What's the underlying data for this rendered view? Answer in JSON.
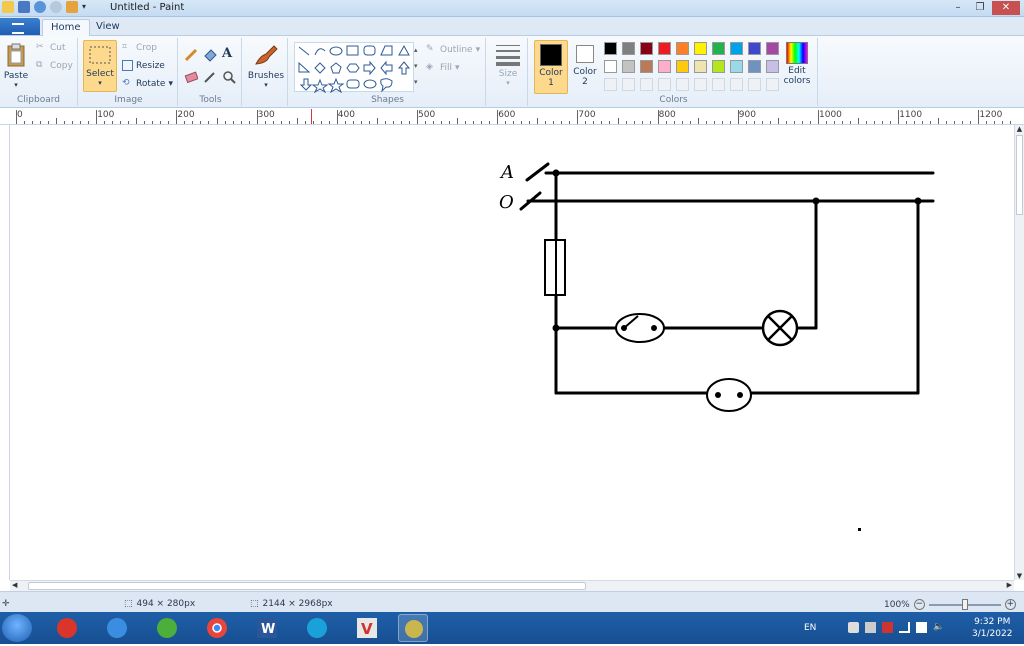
{
  "window": {
    "title": "Untitled - Paint"
  },
  "tabs": [
    {
      "label": "Home"
    },
    {
      "label": "View"
    }
  ],
  "ribbon": {
    "clipboard": {
      "label": "Clipboard",
      "paste": "Paste",
      "cut": "Cut",
      "copy": "Copy"
    },
    "image": {
      "label": "Image",
      "select": "Select",
      "crop": "Crop",
      "resize": "Resize",
      "rotate": "Rotate"
    },
    "tools": {
      "label": "Tools"
    },
    "brushes": {
      "label": "Brushes"
    },
    "shapes": {
      "label": "Shapes",
      "outline": "Outline",
      "fill": "Fill"
    },
    "size": {
      "label": "Size"
    },
    "colors": {
      "label": "Colors",
      "color1": "Color",
      "color1_num": "1",
      "color2": "Color",
      "color2_num": "2",
      "edit": "Edit",
      "edit2": "colors",
      "row1": [
        "#000000",
        "#7f7f7f",
        "#880015",
        "#ed1c24",
        "#ff7f27",
        "#fff200",
        "#22b14c",
        "#00a2e8",
        "#3f48cc",
        "#a349a4"
      ],
      "row2": [
        "#ffffff",
        "#c3c3c3",
        "#b97a57",
        "#ffaec9",
        "#ffc90e",
        "#efe4b0",
        "#b5e61d",
        "#99d9ea",
        "#7092be",
        "#c8bfe7"
      ]
    }
  },
  "ruler": {
    "labels": [
      "0",
      "100",
      "200",
      "300",
      "400",
      "500",
      "600",
      "700",
      "800",
      "900",
      "1000",
      "1100",
      "1200"
    ]
  },
  "diagram": {
    "label_a": "A",
    "label_o": "O"
  },
  "status": {
    "selection_size": "494 × 280px",
    "image_size": "2144 × 2968px",
    "zoom": "100%"
  },
  "tray": {
    "lang": "EN",
    "time": "9:32 PM",
    "date": "3/1/2022"
  }
}
